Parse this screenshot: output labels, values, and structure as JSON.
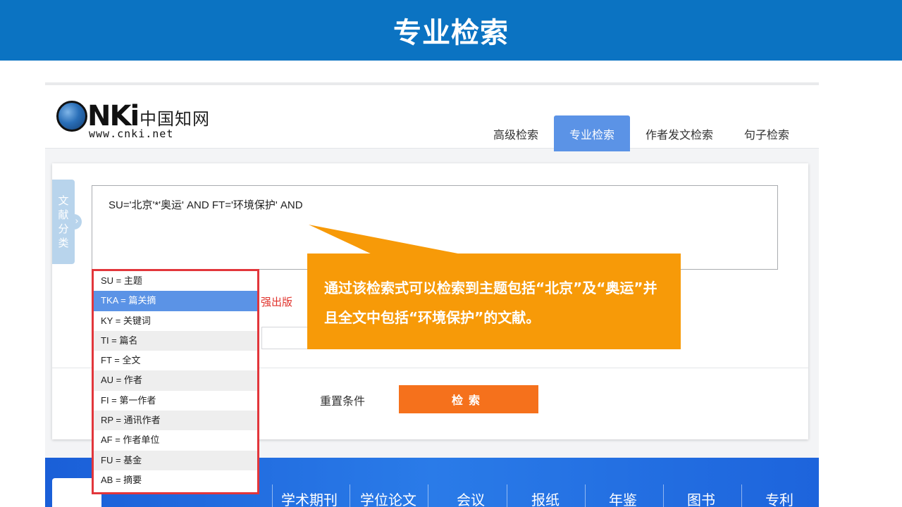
{
  "slide": {
    "title": "专业检索"
  },
  "header": {
    "logo_nki": "NKi",
    "logo_cn": "中国知网",
    "logo_url": "www.cnki.net",
    "tabs": [
      {
        "label": "高级检索",
        "active": false
      },
      {
        "label": "专业检索",
        "active": true
      },
      {
        "label": "作者发文检索",
        "active": false
      },
      {
        "label": "句子检索",
        "active": false
      }
    ]
  },
  "side_tab": {
    "chars": [
      "文",
      "献",
      "分",
      "类"
    ],
    "arrow": "›"
  },
  "query": {
    "text": "SU='北京'*'奥运' AND FT='环境保护' AND"
  },
  "hint_fragment": "强出版",
  "buttons": {
    "reset": "重置条件",
    "search": "检索"
  },
  "dropdown": {
    "items": [
      "SU = 主题",
      "TKA = 篇关摘",
      "KY = 关键词",
      "TI = 篇名",
      "FT = 全文",
      "AU = 作者",
      "FI = 第一作者",
      "RP = 通讯作者",
      "AF = 作者单位",
      "FU = 基金",
      "AB = 摘要"
    ],
    "selected_index": 1
  },
  "callout": {
    "text": "通过该检索式可以检索到主题包括“北京”及“奥运”并且全文中包括“环境保护”的文献。"
  },
  "banner": {
    "labels": [
      "学术期刊",
      "学位论文",
      "会议",
      "报纸",
      "年鉴",
      "图书",
      "专利"
    ]
  },
  "colors": {
    "title_bar": "#0b73c2",
    "tab_active": "#5b93e6",
    "search_button": "#f5711c",
    "callout": "#f79a08",
    "dropdown_border": "#e2363b",
    "banner": "#1d64dc"
  }
}
